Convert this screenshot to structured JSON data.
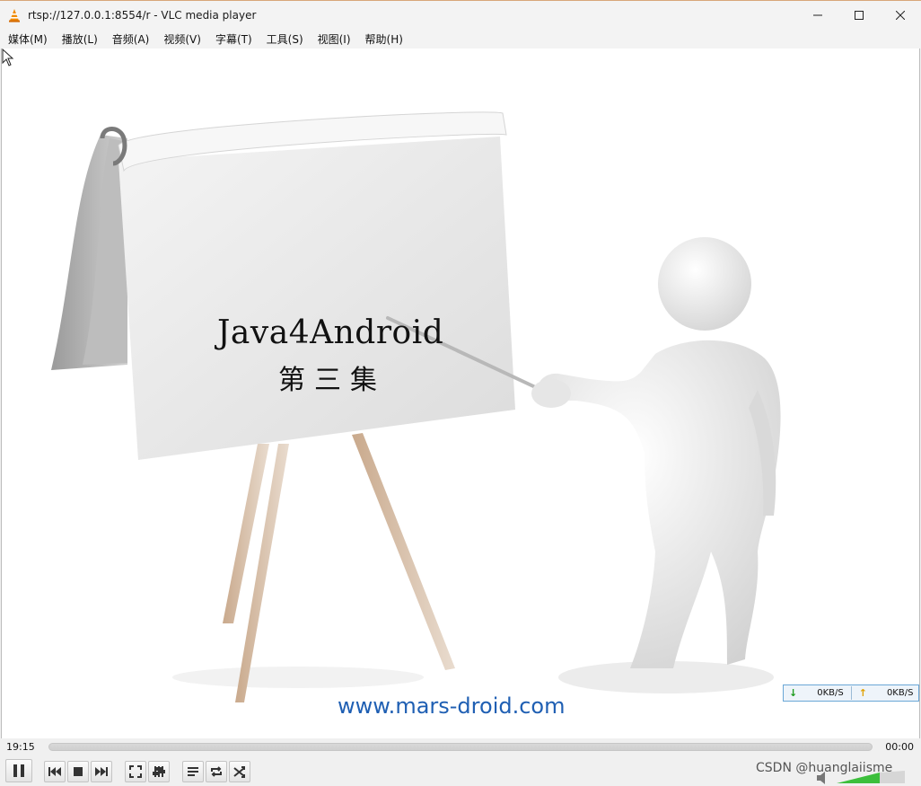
{
  "window": {
    "title": "rtsp://127.0.0.1:8554/r - VLC media player",
    "buttons": {
      "minimize": "–",
      "maximize": "☐",
      "close": "✕"
    }
  },
  "menu": {
    "items": [
      "媒体(M)",
      "播放(L)",
      "音频(A)",
      "视频(V)",
      "字幕(T)",
      "工具(S)",
      "视图(I)",
      "帮助(H)"
    ]
  },
  "video": {
    "title_text": "Java4Android",
    "subtitle_text": "第三集",
    "url_text": "www.mars-droid.com",
    "netspeed": {
      "download": "0KB/S",
      "upload": "0KB/S"
    }
  },
  "playback": {
    "elapsed": "19:15",
    "remaining": "00:00",
    "progress": 0.0
  },
  "watermark": "CSDN @huanglaiisme",
  "colors": {
    "url": "#1f5fb3",
    "vlc_orange": "#f08a00",
    "volume_green": "#3cbf3c"
  }
}
